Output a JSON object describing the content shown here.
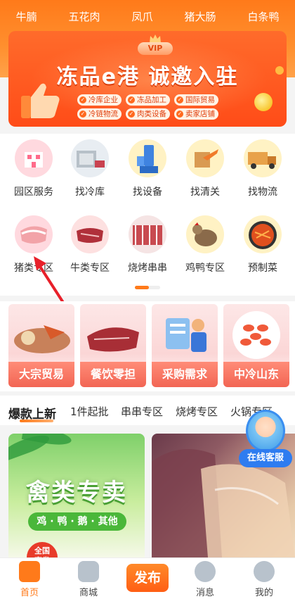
{
  "top_categories": [
    "牛腩",
    "五花肉",
    "凤爪",
    "猪大肠",
    "白条鸭"
  ],
  "banner": {
    "vip": "VIP",
    "title": "冻品e港  诚邀入驻",
    "tags": [
      "冷库企业",
      "冻品加工",
      "国际贸易",
      "冷链物流",
      "肉类设备",
      "卖家店铺"
    ]
  },
  "grid": {
    "row1": [
      {
        "label": "园区服务",
        "icon": "park-service-icon"
      },
      {
        "label": "找冷库",
        "icon": "cold-storage-icon"
      },
      {
        "label": "找设备",
        "icon": "equipment-icon"
      },
      {
        "label": "找清关",
        "icon": "customs-clearance-icon"
      },
      {
        "label": "找物流",
        "icon": "logistics-truck-icon"
      }
    ],
    "row2": [
      {
        "label": "猪类专区",
        "icon": "pork-icon"
      },
      {
        "label": "牛类专区",
        "icon": "beef-icon"
      },
      {
        "label": "烧烤串串",
        "icon": "bbq-skewer-icon"
      },
      {
        "label": "鸡鸭专区",
        "icon": "chicken-icon"
      },
      {
        "label": "预制菜",
        "icon": "prepared-dish-icon"
      }
    ]
  },
  "promos": [
    "大宗贸易",
    "餐饮零担",
    "采购需求",
    "中冷山东"
  ],
  "tabs": [
    "爆款上新",
    "1件起批",
    "串串专区",
    "烧烤专区",
    "火锅专区"
  ],
  "products": {
    "card1": {
      "title": "禽类专卖",
      "subtitle": "鸡 · 鸭 · 鹅 · 其他",
      "badge": "全国\n直发"
    }
  },
  "service": {
    "label": "在线客服"
  },
  "nav": {
    "home": "首页",
    "mall": "商城",
    "publish": "发布",
    "messages": "消息",
    "mine": "我的"
  },
  "colors": {
    "accent": "#ff7a1a",
    "banner": "#ff4c18",
    "promo_label": "#f26554",
    "service": "#2e7cf0"
  }
}
